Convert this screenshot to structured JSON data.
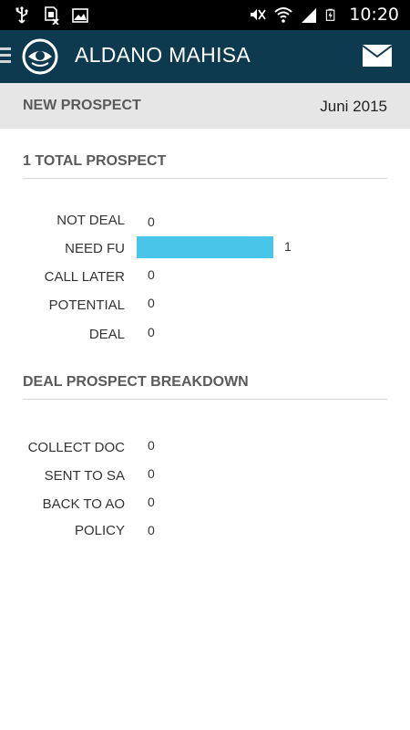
{
  "status_bar": {
    "time": "10:20",
    "icons": [
      "usb-icon",
      "no-sim-icon",
      "image-icon",
      "mute-icon",
      "wifi-icon",
      "signal-icon",
      "battery-charging-icon"
    ]
  },
  "app_bar": {
    "title": "ALDANO MAHISA",
    "icons": [
      "menu-icon",
      "logo-icon",
      "mail-icon"
    ]
  },
  "sub_header": {
    "title": "NEW PROSPECT",
    "date": "Juni 2015"
  },
  "total_section": {
    "title": "1 TOTAL PROSPECT",
    "rows": [
      {
        "label": "NOT DEAL",
        "value": "0",
        "fraction": 0
      },
      {
        "label": "NEED FU",
        "value": "1",
        "fraction": 1
      },
      {
        "label": "CALL LATER",
        "value": "0",
        "fraction": 0
      },
      {
        "label": "POTENTIAL",
        "value": "0",
        "fraction": 0
      },
      {
        "label": "DEAL",
        "value": "0",
        "fraction": 0
      }
    ]
  },
  "deal_section": {
    "title": "DEAL PROSPECT BREAKDOWN",
    "rows": [
      {
        "label": "COLLECT DOC",
        "value": "0",
        "fraction": 0
      },
      {
        "label": "SENT TO SA",
        "value": "0",
        "fraction": 0
      },
      {
        "label": "BACK TO AO",
        "value": "0",
        "fraction": 0
      },
      {
        "label": "POLICY",
        "value": "0",
        "fraction": 0
      }
    ]
  },
  "colors": {
    "app_bar": "#0e3a50",
    "bar": "#48c5e8",
    "sub_header": "#e6e6e6"
  }
}
